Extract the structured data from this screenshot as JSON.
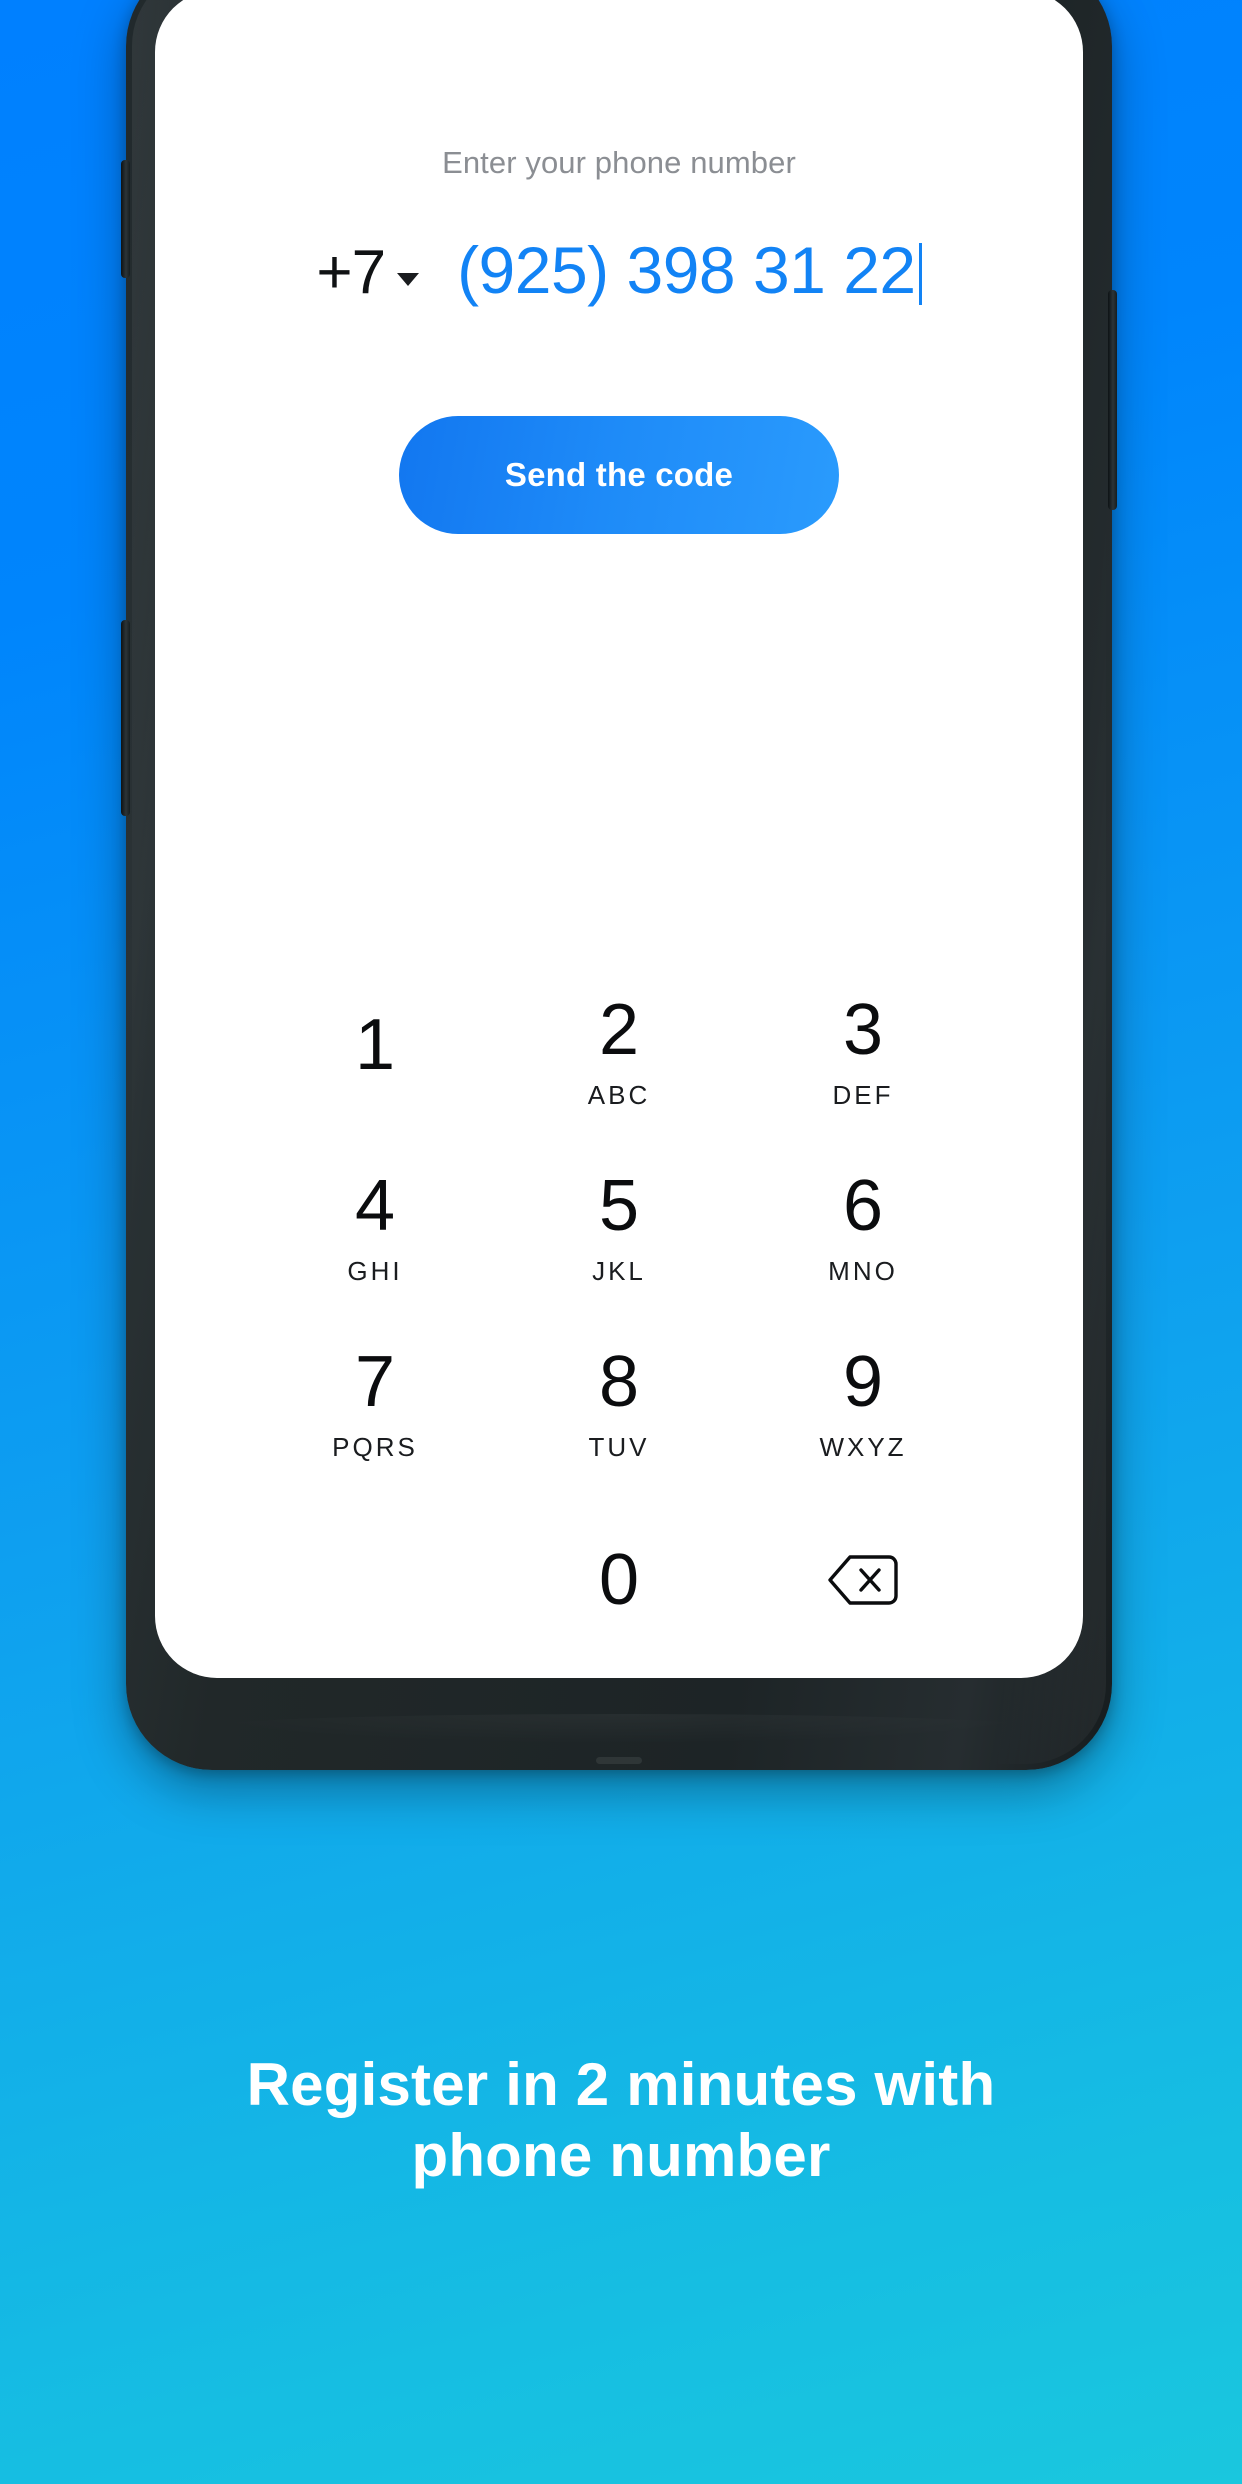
{
  "theme": {
    "background_gradient_start": "#0080FF",
    "background_gradient_end": "#1AC7DE",
    "accent_blue": "#1283F5",
    "device_body": "#212829",
    "screen_background": "#FFFFFF"
  },
  "screen": {
    "prompt_label": "Enter your phone number",
    "country_code": "+7",
    "country_code_dropdown_icon": "chevron-down-icon",
    "phone_number": "(925) 398 31 22",
    "cta_label": "Send the code"
  },
  "keypad": {
    "keys": [
      {
        "digit": "1",
        "letters": ""
      },
      {
        "digit": "2",
        "letters": "ABC"
      },
      {
        "digit": "3",
        "letters": "DEF"
      },
      {
        "digit": "4",
        "letters": "GHI"
      },
      {
        "digit": "5",
        "letters": "JKL"
      },
      {
        "digit": "6",
        "letters": "MNO"
      },
      {
        "digit": "7",
        "letters": "PQRS"
      },
      {
        "digit": "8",
        "letters": "TUV"
      },
      {
        "digit": "9",
        "letters": "WXYZ"
      },
      {
        "digit": "",
        "letters": ""
      },
      {
        "digit": "0",
        "letters": ""
      },
      {
        "digit": "backspace-icon",
        "letters": ""
      }
    ]
  },
  "caption": {
    "line1": "Register in 2 minutes with",
    "line2": "phone number"
  }
}
